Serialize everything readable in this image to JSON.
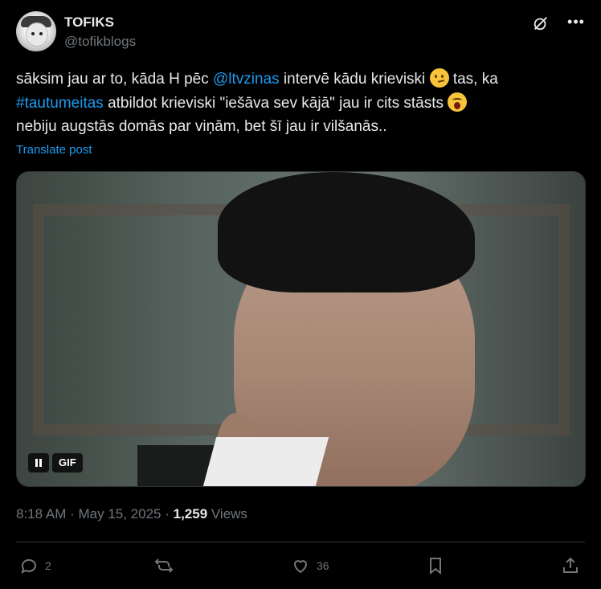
{
  "author": {
    "name": "TOFIKS",
    "handle": "@tofikblogs"
  },
  "tweet": {
    "p1": "sāksim jau ar to, kāda H pēc ",
    "mention": "@ltvzinas",
    "p2": " intervē kādu krieviski ",
    "p3": " tas, ka ",
    "hashtag": "#tautumeitas",
    "p4": " atbildot krieviski \"iešāva sev kājā\" jau ir cits stāsts ",
    "p5": "nebiju augstās domās par viņām, bet šī jau ir vilšanās..",
    "translate": "Translate post"
  },
  "media": {
    "gif_label": "GIF"
  },
  "meta": {
    "time": "8:18 AM",
    "dot1": " · ",
    "date": "May 15, 2025",
    "dot2": " · ",
    "views_count": "1,259",
    "views_label": " Views"
  },
  "actions": {
    "replies": "2",
    "reposts": "",
    "likes": "36"
  },
  "colors": {
    "background": "#000000",
    "text": "#e7e9ea",
    "muted": "#71767b",
    "link": "#1d9bf0",
    "divider": "#2f3336"
  }
}
